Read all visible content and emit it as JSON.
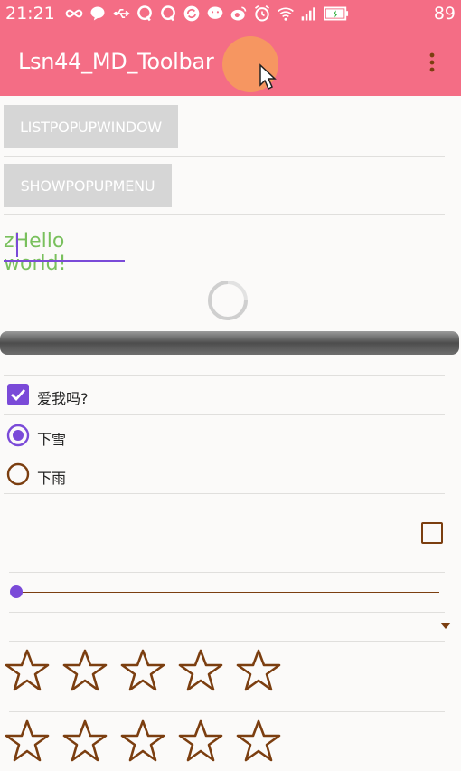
{
  "status_bar": {
    "time": "21:21",
    "battery": "89",
    "icons": [
      "infinity-icon",
      "chat-icon",
      "usb-icon",
      "qq-icon",
      "qq-icon",
      "sync-icon",
      "wechat-icon",
      "weibo-icon",
      "alarm-icon",
      "wifi-icon",
      "signal-icon",
      "battery-icon"
    ]
  },
  "toolbar": {
    "title": "Lsn44_MD_Toolbar",
    "color": "#f46d85"
  },
  "buttons": {
    "list_popup": "LISTPOPUPWINDOW",
    "show_popup": "SHOWPOPUPMENU"
  },
  "edit_text": {
    "prefix": "z",
    "value": "Hello world!"
  },
  "checkbox": {
    "label": "爱我吗?",
    "checked": true
  },
  "radios": [
    {
      "label": "下雪",
      "checked": true
    },
    {
      "label": "下雨",
      "checked": false
    }
  ],
  "checkbox2": {
    "checked": false
  },
  "seekbar": {
    "value": 0
  },
  "rating_bars": [
    {
      "stars": 5,
      "rating": 0
    },
    {
      "stars": 5,
      "rating": 0
    }
  ],
  "colors": {
    "accent": "#7a4ad8",
    "control": "#7b3e10",
    "edit_text": "#79c05d"
  }
}
